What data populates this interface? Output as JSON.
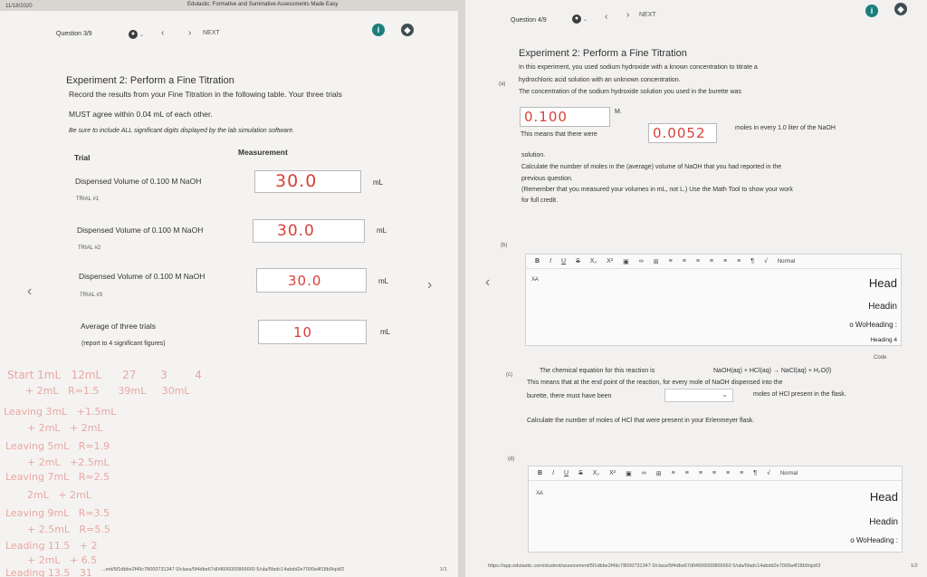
{
  "header": {
    "date": "11/18/2020",
    "title": "Edulastic: Formative and Summative Assessments Made Easy"
  },
  "left": {
    "question_label": "Question 3/9",
    "next_label": "NEXT",
    "exp_title": "Experiment 2: Perform a Fine Titration",
    "instructions_1": "Record the results from your Fine Titration in the following table. Your three trials",
    "instructions_2": "MUST agree within 0.04 mL of each other.",
    "note": "Be sure to include ALL significant digits displayed by the lab simulation software.",
    "col_trial": "Trial",
    "col_measurement": "Measurement",
    "rows": [
      {
        "label": "Dispensed Volume of 0.100 M NaOH",
        "sub": "TRIAL #1",
        "value": "30.0",
        "unit": "mL"
      },
      {
        "label": "Dispensed Volume of 0.100 M NaOH",
        "sub": "TRIAL #2",
        "value": "30.0",
        "unit": "mL"
      },
      {
        "label": "Dispensed Volume of 0.100 M NaOH",
        "sub": "TRIAL #3",
        "value": "30.0",
        "unit": "mL"
      }
    ],
    "avg_label": "Average of three trials",
    "avg_sub": "(report to 4 significant figures)",
    "avg_value": "10",
    "avg_unit": "mL",
    "footer_url": "...ent/5f1dbbe2f49c78000731347 0/class/5f4dbe67d04606000866660 5/ula/5fadc14abdd2e7000a4f18b9/qid/2",
    "footer_page": "1/1"
  },
  "right": {
    "question_label": "Question 4/9",
    "next_label": "NEXT",
    "exp_title": "Experiment 2: Perform a Fine Titration",
    "part_a": "(a)",
    "a_line1": "In this experiment, you used sodium hydroxide with a known concentration to titrate a",
    "a_line2": "hydrochloric acid solution with an unknown concentration.",
    "a_line3": "The concentration of the sodium hydroxide solution you used in the burette was",
    "conc_value": "0.100",
    "conc_unit": "M.",
    "this_means": "This means that there were",
    "moles_value": "0.0052",
    "moles_text": "moles in every 1.0 liter of the NaOH",
    "solution": "solution.",
    "calc_1": "Calculate the number of moles in the (average) volume of NaOH that you had reported in the",
    "calc_2": "previous question.",
    "calc_3": "(Remember that you measured your volumes in mL, not L.)  Use the Math Tool to show your work",
    "calc_4": "for full credit.",
    "part_b": "(b)",
    "part_c": "(c)",
    "part_d": "(d)",
    "eq_intro": "The chemical equation for this reaction is",
    "eq_text": "NaOH(aq) + HCl(aq)  →  NaCl(aq) + H₂O(l)",
    "c_line2": "This means that at the end point of the reaction, for every mole of NaOH dispensed into the",
    "c_line3": "burette, there must have been",
    "c_line3b": "moles of HCl present in the flask.",
    "c_calc": "Calculate the number of moles of HCl that were present in your Erlenmeyer flask.",
    "toolbar": [
      "B",
      "I",
      "U",
      "S",
      "X₂",
      "X²",
      "▣",
      "∞",
      "⊞",
      "≡",
      "≡",
      "≡",
      "≡",
      "≡",
      "≡",
      "¶",
      "√"
    ],
    "normal": "Normal",
    "styles_b": [
      "Head",
      "Headin",
      "o WoHeading :",
      "Heading 4",
      "Code"
    ],
    "styles_d": [
      "Head",
      "Headin",
      "o WoHeading :"
    ],
    "footer_url": "https://app.edulastic.com/student/assessment/5f1dbbe2f49c78000731347 0/class/5f4dbe67d04606000866660 5/ula/5fadc14abdd2e7000a4f18b9/qid/3",
    "footer_page": "1/2"
  }
}
